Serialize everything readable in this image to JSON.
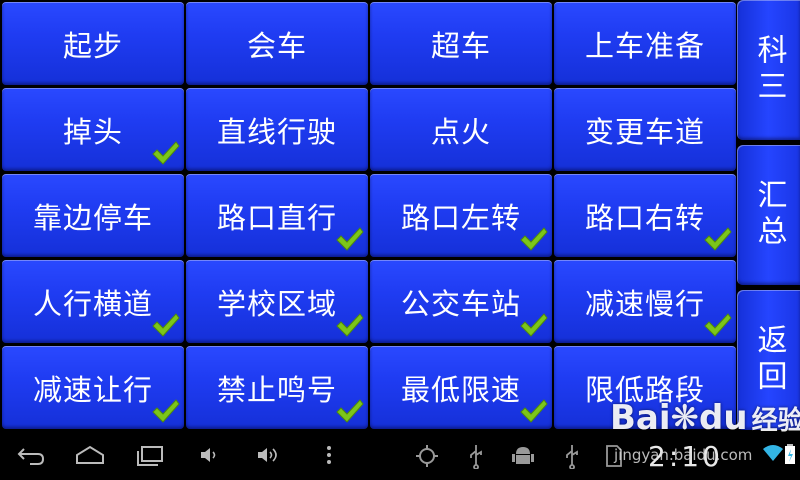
{
  "tiles": [
    {
      "label": "起步",
      "checked": false
    },
    {
      "label": "会车",
      "checked": false
    },
    {
      "label": "超车",
      "checked": false
    },
    {
      "label": "上车准备",
      "checked": false
    },
    {
      "label": "掉头",
      "checked": true
    },
    {
      "label": "直线行驶",
      "checked": false
    },
    {
      "label": "点火",
      "checked": false
    },
    {
      "label": "变更车道",
      "checked": false
    },
    {
      "label": "靠边停车",
      "checked": false
    },
    {
      "label": "路口直行",
      "checked": true
    },
    {
      "label": "路口左转",
      "checked": true
    },
    {
      "label": "路口右转",
      "checked": true
    },
    {
      "label": "人行横道",
      "checked": true
    },
    {
      "label": "学校区域",
      "checked": true
    },
    {
      "label": "公交车站",
      "checked": true
    },
    {
      "label": "减速慢行",
      "checked": true
    },
    {
      "label": "减速让行",
      "checked": true
    },
    {
      "label": "禁止鸣号",
      "checked": true
    },
    {
      "label": "最低限速",
      "checked": true
    },
    {
      "label": "限低路段",
      "checked": false
    }
  ],
  "side": {
    "subject": "科三",
    "summary": "汇总",
    "back": "返回"
  },
  "statusbar": {
    "clock": "2:10"
  },
  "watermark": {
    "logo_text": "Bai",
    "logo_suffix": "du",
    "logo_cn": "经验",
    "url": "jingyan.baidu.com"
  },
  "colors": {
    "tile_blue": "#1f3cf2",
    "check_green": "#7cc61a",
    "background": "#000000"
  }
}
